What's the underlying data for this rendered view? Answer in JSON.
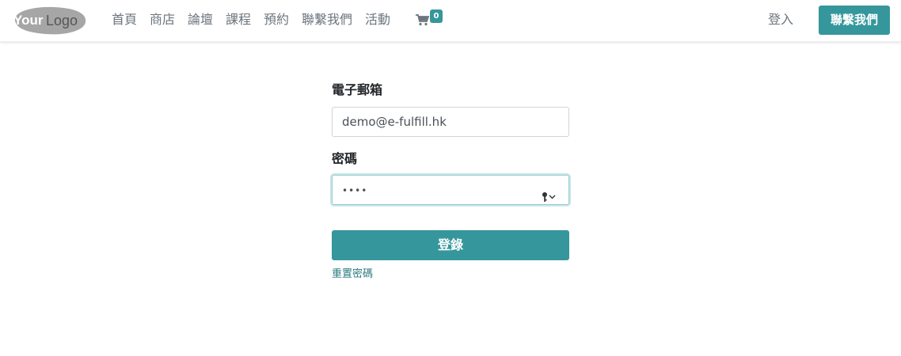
{
  "brand": {
    "logo_text_a": "Your",
    "logo_text_b": "Logo",
    "accent": "#35979c"
  },
  "nav": {
    "items": [
      {
        "label": "首頁"
      },
      {
        "label": "商店"
      },
      {
        "label": "論壇"
      },
      {
        "label": "課程"
      },
      {
        "label": "預約"
      },
      {
        "label": "聯繫我們"
      },
      {
        "label": "活動"
      }
    ],
    "cart_icon": "cart-icon",
    "cart_count": "0",
    "login_label": "登入",
    "contact_button_label": "聯繫我們"
  },
  "form": {
    "email_label": "電子郵箱",
    "email_value": "demo@e-fulfill.hk",
    "password_label": "密碼",
    "password_mask": "••••",
    "password_icon": "key-icon",
    "submit_label": "登錄",
    "reset_link": "重置密碼"
  }
}
